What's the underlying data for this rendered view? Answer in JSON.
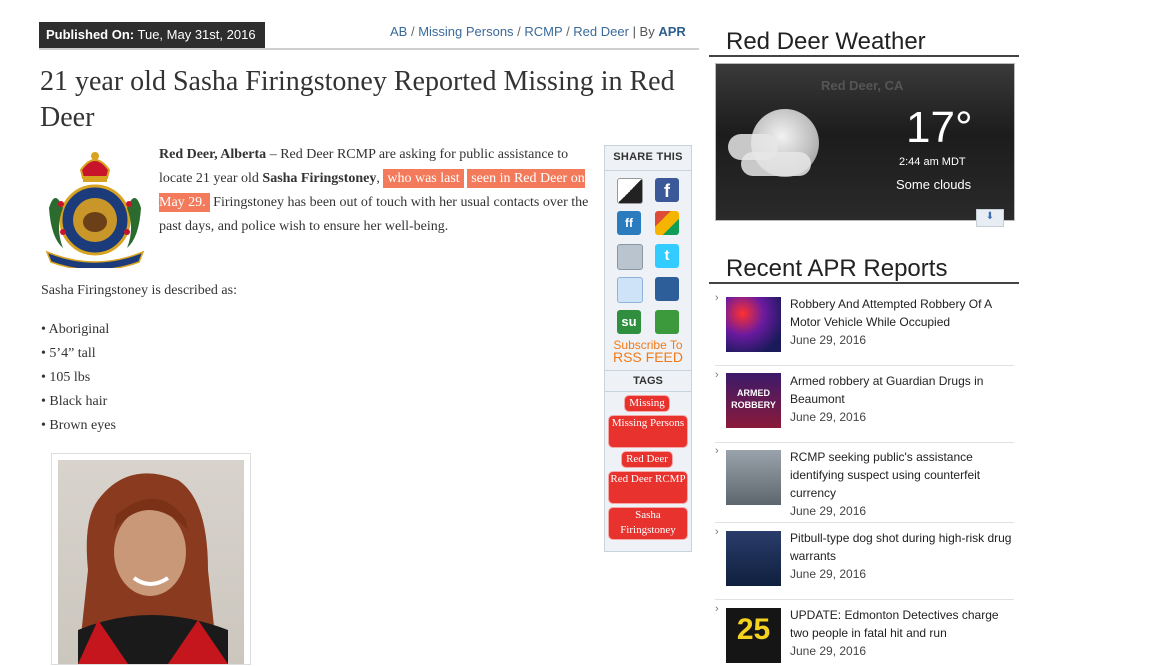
{
  "meta": {
    "published_label": "Published On:",
    "published_date": "Tue, May 31st, 2016",
    "crumbs": [
      "AB",
      "Missing Persons",
      "RCMP",
      "Red Deer"
    ],
    "crumb_sep": " / ",
    "by_label": "| By",
    "author": "APR"
  },
  "article": {
    "title": "21 year old Sasha Firingstoney Reported Missing in Red Deer",
    "lead_location": "Red Deer, Alberta",
    "lead_dash": " – Red Deer RCMP are asking for public assistance to locate 21 year old ",
    "lead_name": "Sasha Firingstoney",
    "lead_comma": ",",
    "highlight_1": "who was last",
    "highlight_2": "seen in Red Deer on May 29.",
    "lead_rest": " Firingstoney has been out of touch with her usual contacts over the past days, and police wish to ensure her well-being.",
    "described_as": "Sasha Firingstoney is described as:",
    "traits": [
      "• Aboriginal",
      "• 5’4” tall",
      "• 105 lbs",
      "• Black hair",
      "• Brown eyes"
    ]
  },
  "share": {
    "header": "SHARE THIS",
    "icons": [
      "delicious-icon",
      "facebook-icon",
      "friendfeed-icon",
      "google-icon",
      "mixx-icon",
      "twitter-icon",
      "reddit-icon",
      "myspace-icon",
      "stumbleupon-icon",
      "technorati-icon"
    ],
    "rss_line1": "Subscribe To",
    "rss_line2": "RSS FEED",
    "tags_header": "TAGS",
    "tags": [
      "Missing",
      "Missing Persons",
      "Red Deer",
      "Red Deer RCMP",
      "Sasha Firingstoney"
    ]
  },
  "weather": {
    "heading": "Red Deer Weather",
    "city": "Red Deer, CA",
    "temp": "17°",
    "time": "2:44 am MDT",
    "condition": "Some clouds"
  },
  "recent": {
    "heading": "Recent APR Reports",
    "items": [
      {
        "title": "Robbery And Attempted Robbery Of A Motor Vehicle While Occupied",
        "date": "June 29, 2016"
      },
      {
        "title": "Armed robbery at Guardian Drugs in Beaumont",
        "date": "June 29, 2016",
        "thumb_text": "ARMED ROBBERY"
      },
      {
        "title": "RCMP seeking public's assistance identifying suspect using counterfeit currency",
        "date": "June 29, 2016"
      },
      {
        "title": "Pitbull-type dog shot during high-risk drug warrants",
        "date": "June 29, 2016"
      },
      {
        "title": "UPDATE: Edmonton Detectives charge two people in fatal hit and run",
        "date": "June 29, 2016",
        "thumb_text": "25"
      }
    ]
  },
  "colors": {
    "highlight": "#f37b5c",
    "tag": "#e8322e",
    "link": "#3a6a9a"
  }
}
